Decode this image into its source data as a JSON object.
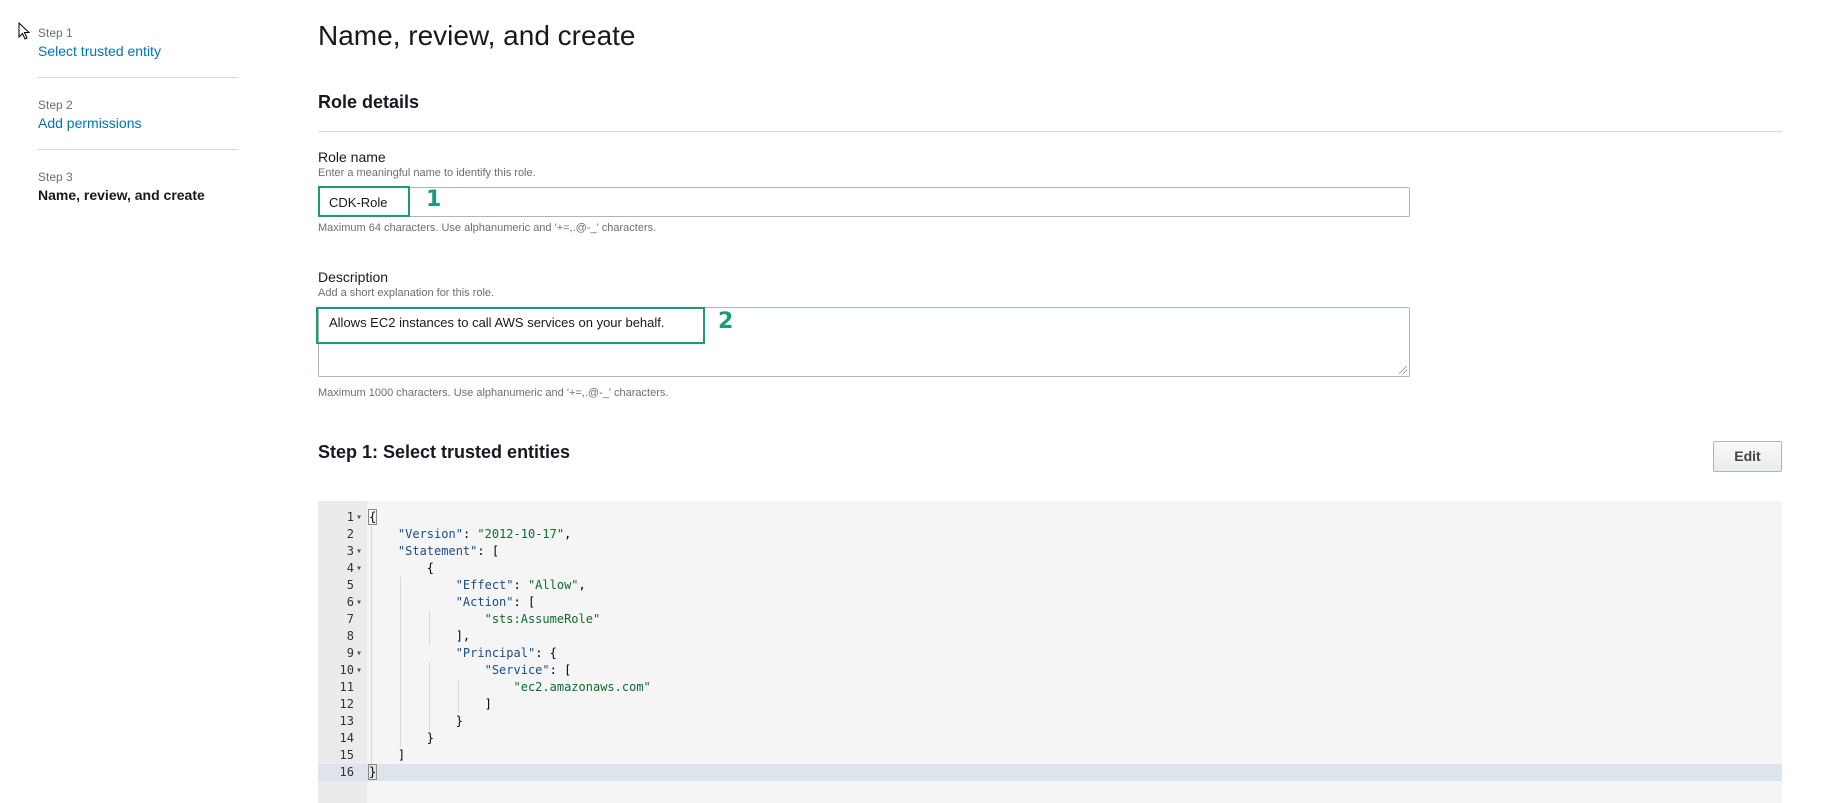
{
  "sidebar": {
    "steps": [
      {
        "num": "Step 1",
        "label": "Select trusted entity"
      },
      {
        "num": "Step 2",
        "label": "Add permissions"
      },
      {
        "num": "Step 3",
        "label": "Name, review, and create"
      }
    ]
  },
  "main": {
    "page_title": "Name, review, and create",
    "section_title": "Role details",
    "role_name": {
      "label": "Role name",
      "hint": "Enter a meaningful name to identify this role.",
      "value": "CDK-Role",
      "constraint": "Maximum 64 characters. Use alphanumeric and '+=,.@-_' characters.",
      "annotation": "1"
    },
    "description": {
      "label": "Description",
      "hint": "Add a short explanation for this role.",
      "value": "Allows EC2 instances to call AWS services on your behalf.",
      "constraint": "Maximum 1000 characters. Use alphanumeric and '+=,.@-_' characters.",
      "annotation": "2"
    },
    "trusted_entities": {
      "title": "Step 1: Select trusted entities",
      "edit_label": "Edit"
    }
  },
  "policy_editor": {
    "line_numbers": [
      "1",
      "2",
      "3",
      "4",
      "5",
      "6",
      "7",
      "8",
      "9",
      "10",
      "11",
      "12",
      "13",
      "14",
      "15",
      "16"
    ],
    "lines": [
      "{",
      "    \"Version\": \"2012-10-17\",",
      "    \"Statement\": [",
      "        {",
      "            \"Effect\": \"Allow\",",
      "            \"Action\": [",
      "                \"sts:AssumeRole\"",
      "            ],",
      "            \"Principal\": {",
      "                \"Service\": [",
      "                    \"ec2.amazonaws.com\"",
      "                ]",
      "            }",
      "        }",
      "    ]",
      "}"
    ]
  },
  "colors": {
    "link": "#0073bb",
    "annotation": "#1a9c7a",
    "json_key": "#1a4b8c",
    "json_string": "#0d6b2f"
  }
}
